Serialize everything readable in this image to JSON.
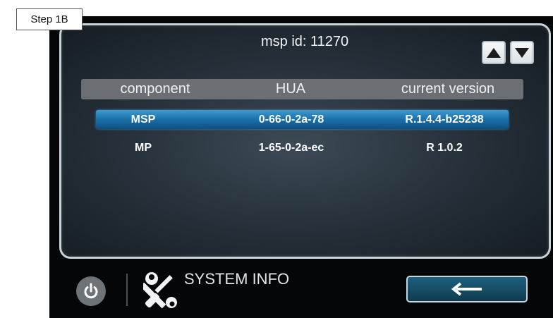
{
  "step_label": "Step 1B",
  "msp_id": "msp id: 11270",
  "table": {
    "headers": [
      "component",
      "HUA",
      "current version"
    ],
    "rows": [
      {
        "component": "MSP",
        "hua": "0-66-0-2a-78",
        "version": "R.1.4.4-b25238",
        "selected": true
      },
      {
        "component": "MP",
        "hua": "1-65-0-2a-ec",
        "version": "R 1.0.2",
        "selected": false
      }
    ]
  },
  "footer": {
    "title": "SYSTEM INFO",
    "power_icon": "power-icon",
    "tools_icon": "tools-icon",
    "back_icon": "arrow-left-icon"
  },
  "colors": {
    "selected_row": "#1b6fa8",
    "header_bar": "#6b6e72",
    "back_button": "#154a62"
  }
}
